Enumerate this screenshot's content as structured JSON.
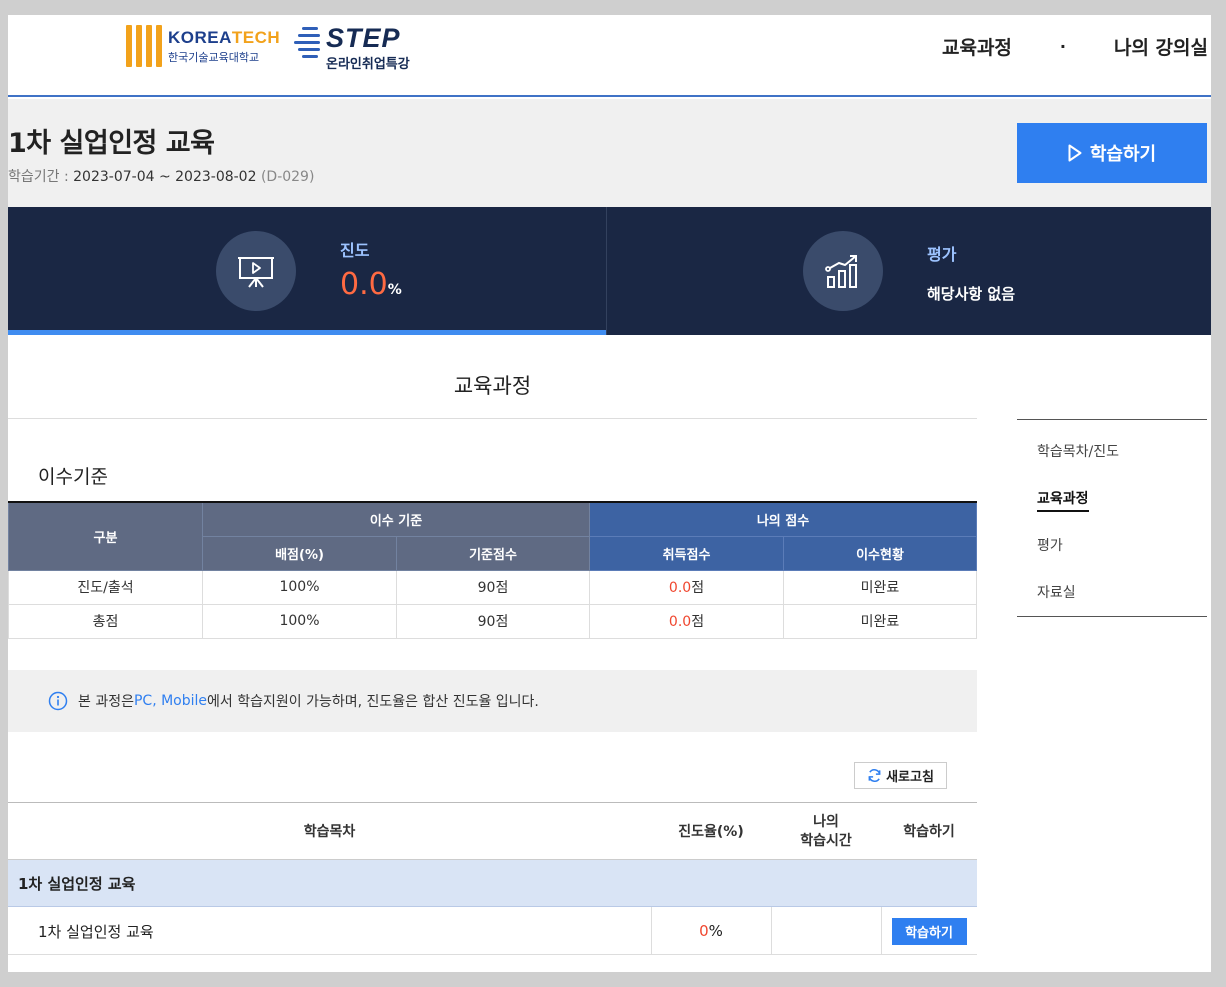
{
  "header": {
    "logo_korea_en_1": "KOREA",
    "logo_korea_en_2": "TECH",
    "logo_korea_ko": "한국기술교육대학교",
    "logo_step": "STEP",
    "logo_step_sub": "온라인취업특강",
    "nav": [
      "교육과정",
      "·",
      "나의 강의실"
    ]
  },
  "course": {
    "title": "1차 실업인정 교육",
    "period_label": "학습기간 : ",
    "period_value": "2023-07-04 ~ 2023-08-02",
    "dday": "(D-029)",
    "study_button": "학습하기"
  },
  "stats": {
    "progress_label": "진도",
    "progress_value": "0.0",
    "progress_unit": "%",
    "eval_label": "평가",
    "eval_value": "해당사항 없음"
  },
  "main": {
    "section_title": "교육과정",
    "criteria_title": "이수기준",
    "criteria_table": {
      "col_category": "구분",
      "group_criteria": "이수 기준",
      "group_my_score": "나의 점수",
      "col_weight": "배점(%)",
      "col_base": "기준점수",
      "col_earned": "취득점수",
      "col_status": "이수현황",
      "rows": [
        {
          "category": "진도/출석",
          "weight": "100%",
          "base": "90점",
          "earned_num": "0.0",
          "earned_unit": "점",
          "status": "미완료"
        },
        {
          "category": "총점",
          "weight": "100%",
          "base": "90점",
          "earned_num": "0.0",
          "earned_unit": "점",
          "status": "미완료"
        }
      ]
    },
    "notice_prefix": "본 과정은 ",
    "notice_platforms": "PC, Mobile",
    "notice_suffix": " 에서 학습지원이 가능하며, 진도율은 합산 진도율 입니다.",
    "refresh_button": "새로고침",
    "lesson_table": {
      "col_title": "학습목차",
      "col_progress": "진도율(%)",
      "col_time_1": "나의",
      "col_time_2": "학습시간",
      "col_action": "학습하기",
      "group_title": "1차 실업인정 교육",
      "row": {
        "title": "1차 실업인정 교육",
        "progress_num": "0",
        "progress_unit": "%",
        "time": "",
        "action": "학습하기"
      }
    }
  },
  "side_nav": {
    "items": [
      "학습목차/진도",
      "교육과정",
      "평가",
      "자료실"
    ],
    "active": "교육과정"
  },
  "colors": {
    "accent": "#2f7ff0",
    "navy": "#1a2744",
    "highlight_red": "#f0472f"
  }
}
